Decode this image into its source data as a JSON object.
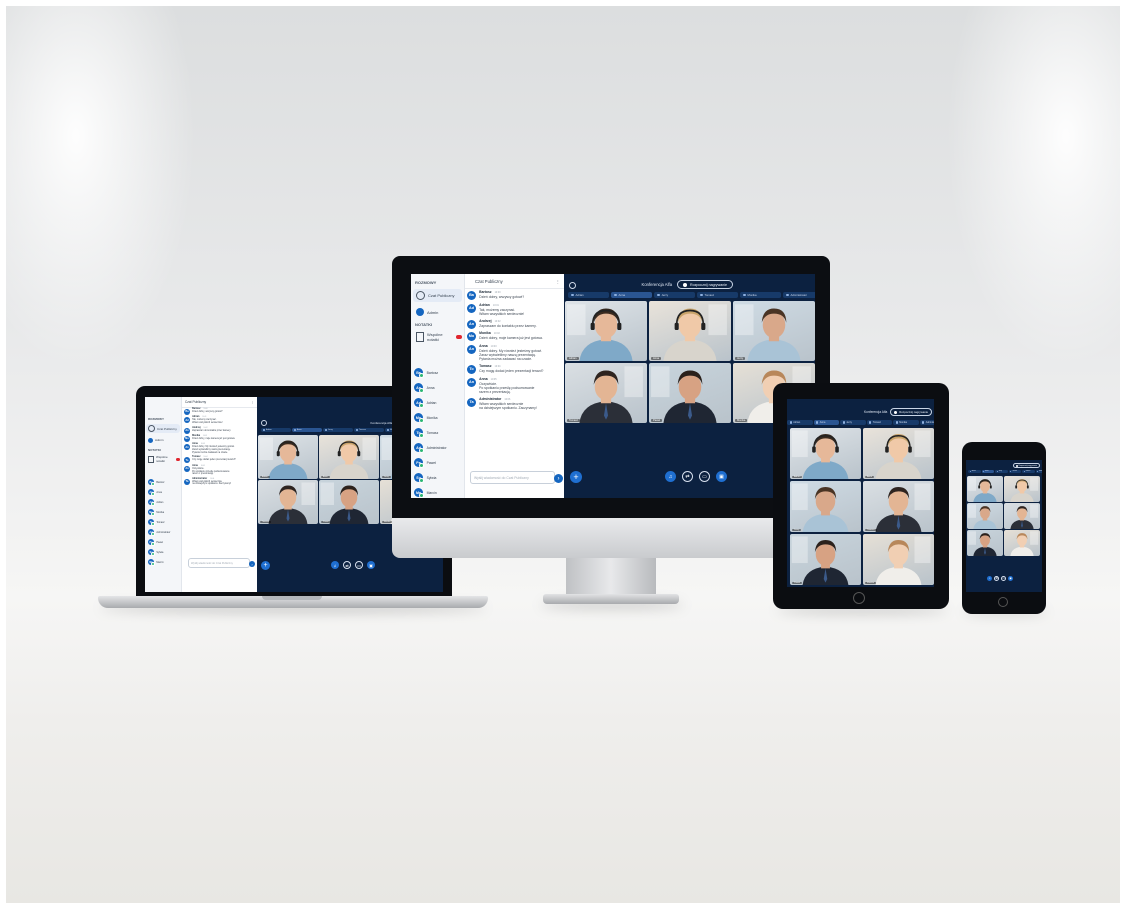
{
  "app": {
    "nav_section_conversations": "ROZMOWY",
    "nav_section_notes": "NOTATKI",
    "nav_public_chat": "Czat Publiczny",
    "nav_admin": "Admin",
    "nav_notes_item": "Wspólne notatki",
    "chat_title": "Czat Publiczny",
    "chat_input_placeholder": "Wyślij wiadomość do Czat Publiczny",
    "conference_title": "Konferencja Alfa",
    "recording_label": "Rozpocznij nagrywanie",
    "participants": [
      "Bartosz",
      "Anna",
      "Adrian",
      "Monika",
      "Tomasz",
      "Administrator",
      "Paweł",
      "Sylwia",
      "Marcin"
    ],
    "pills": [
      "Adrian",
      "Anna",
      "Jerzy",
      "Tomasz",
      "Monika",
      "Administrator"
    ],
    "tile_names": [
      "Adrian",
      "Anna",
      "Jerzy",
      "Tomasz",
      "Paweł",
      "Monika"
    ],
    "messages": [
      {
        "initials": "Ba",
        "author": "Bartosz",
        "time": "10:00",
        "text": "Dzień dobry, wszyscy gotowi?"
      },
      {
        "initials": "Ad",
        "author": "Adrian",
        "time": "10:01",
        "text": "Tak, możemy zaczynać.\nWitam wszystkich serdecznie!"
      },
      {
        "initials": "An",
        "author": "Andrzej",
        "time": "10:02",
        "text": "Zapraszam do kontaktu przez kamery."
      },
      {
        "initials": "Mo",
        "author": "Monika",
        "time": "10:02",
        "text": "Dzień dobry, moje kamera już jest gotowa."
      },
      {
        "initials": "An",
        "author": "Anna",
        "time": "10:03",
        "text": "Dzień dobry. My również jesteśmy gotowi.\nZaraz wyświetlimy naszą prezentację.\nPytania można zadawać na czacie."
      },
      {
        "initials": "To",
        "author": "Tomasz",
        "time": "10:04",
        "text": "Czy mogę dodać jeden prezentacji terazd?"
      },
      {
        "initials": "An",
        "author": "Anna",
        "time": "10:05",
        "text": "Oczywiście.\nPo spotkaniu prześlę podsumowanie\nrazem z prezentacją."
      },
      {
        "initials": "Ta",
        "author": "Administrator",
        "time": "10:06",
        "text": "Witam wszystkich serdecznie\nna dzisiejszym spotkaniu. Zaczynamy!"
      }
    ]
  },
  "colors": {
    "accent": "#1566c0",
    "dark_bg": "#0c2140",
    "online": "#2bb673",
    "alert": "#e0262f"
  },
  "icons": [
    "person-icon",
    "plus-icon",
    "send-icon",
    "headset-icon",
    "screen-share-icon",
    "chat-bubble-icon",
    "presentation-icon",
    "menu-dots-icon",
    "document-icon"
  ]
}
